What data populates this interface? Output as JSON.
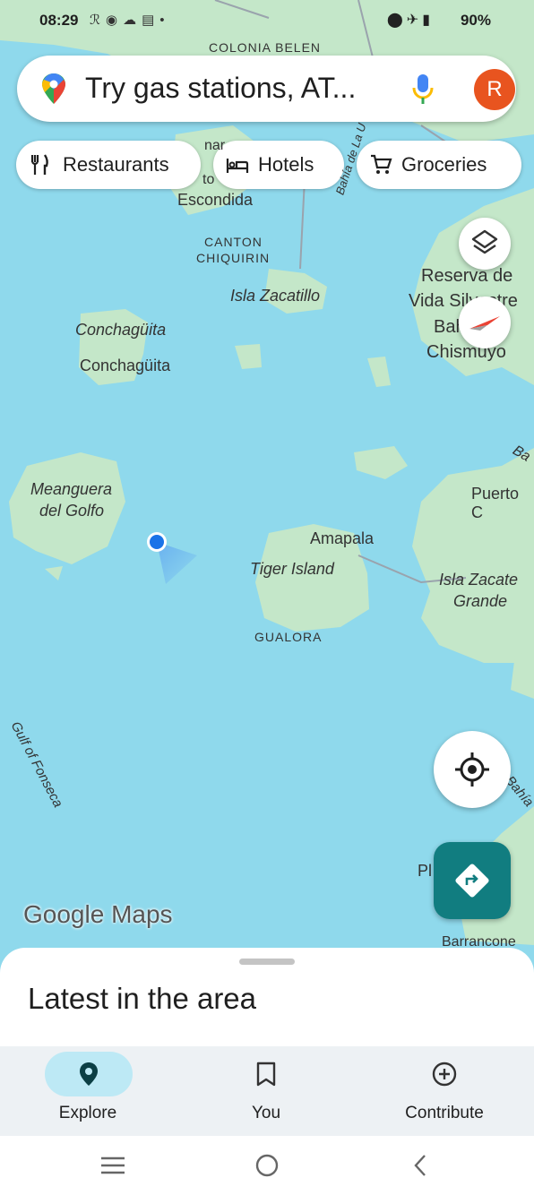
{
  "status_bar": {
    "time": "08:29",
    "battery": "90%"
  },
  "search": {
    "placeholder": "Try gas stations, AT...",
    "avatar_letter": "R"
  },
  "chips": [
    {
      "label": "Restaurants",
      "icon": "fork-knife-icon"
    },
    {
      "label": "Hotels",
      "icon": "bed-icon"
    },
    {
      "label": "Groceries",
      "icon": "cart-icon"
    }
  ],
  "map_labels": {
    "colonia_belen": "COLONIA BELEN",
    "nar": "nar",
    "to": "to",
    "escondida": "Escondida",
    "bahia_la": "Bahía de La U",
    "canton": "CANTON",
    "chiquirin": "CHIQUIRIN",
    "isla_zacatillo": "Isla Zacatillo",
    "reserva1": "Reserva de",
    "reserva2": "Vida Silvestre",
    "reserva3": "Bahía",
    "reserva4": "Chismuyo",
    "conchaguita1": "Conchagüita",
    "conchaguita2": "Conchagüita",
    "ba": "Ba",
    "meanguera1": "Meanguera",
    "meanguera2": "del Golfo",
    "puerto": "Puerto C",
    "amapala": "Amapala",
    "tiger_island": "Tiger Island",
    "isla_zacate1": "Isla Zacate",
    "isla_zacate2": "Grande",
    "gualora": "GUALORA",
    "gulf": "Gulf of Fonseca",
    "bahia_right": "Bahía",
    "pl": "Pl",
    "barrancones": "Barrancone"
  },
  "logo": "Google Maps",
  "sheet": {
    "title": "Latest in the area"
  },
  "nav": [
    {
      "label": "Explore",
      "icon": "explore-pin-icon",
      "active": true
    },
    {
      "label": "You",
      "icon": "bookmark-icon",
      "active": false
    },
    {
      "label": "Contribute",
      "icon": "add-circle-icon",
      "active": false
    }
  ],
  "colors": {
    "water": "#8fd9ec",
    "land": "#c4e7c9",
    "accent": "#117d80",
    "avatar": "#e8541f",
    "nav_pill": "#bde9f5"
  }
}
